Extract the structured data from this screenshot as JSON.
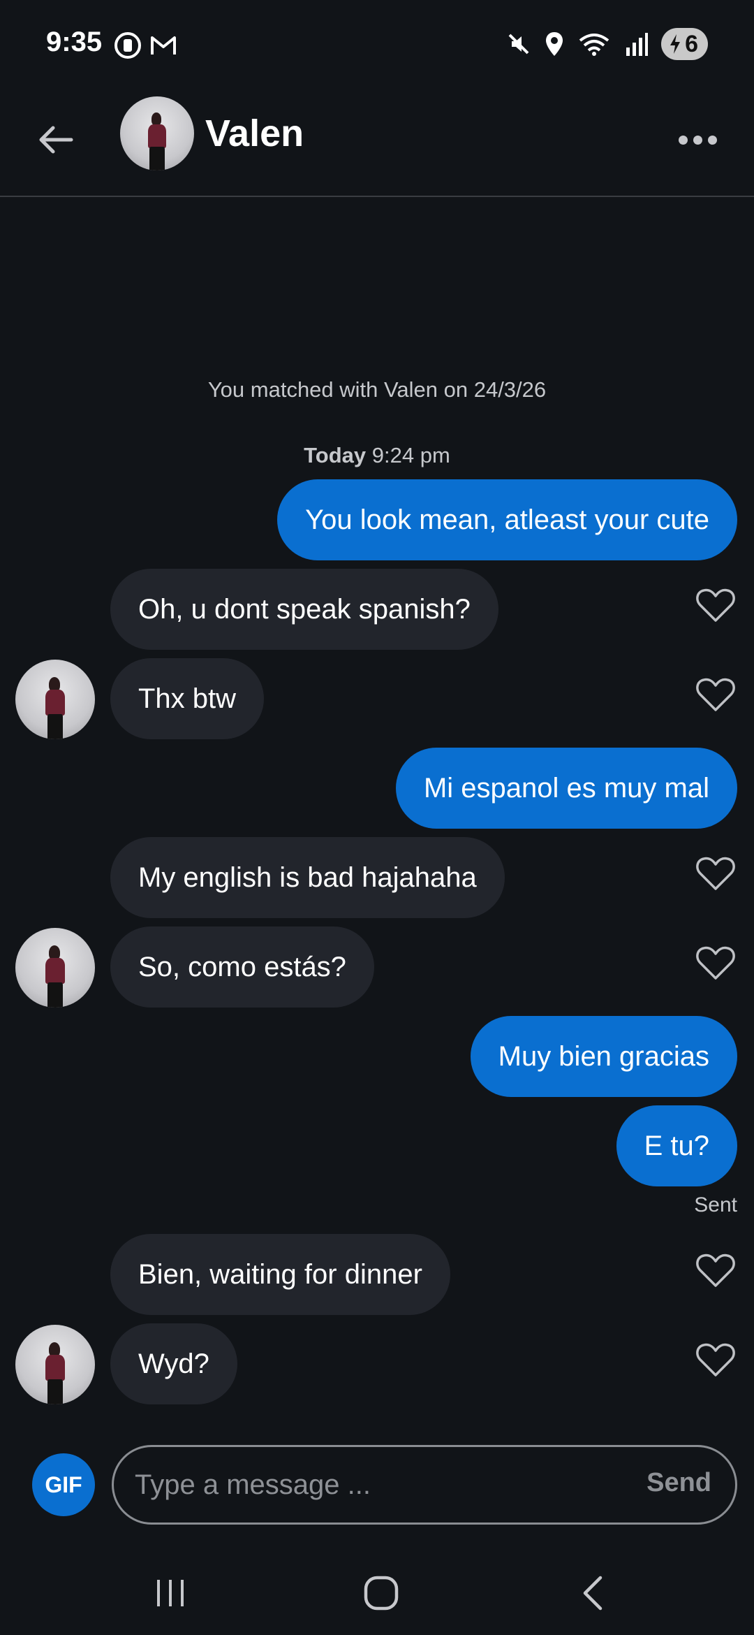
{
  "status_bar": {
    "time": "9:35",
    "battery": "6",
    "icons": [
      "whatsapp-icon",
      "gmail-icon",
      "mute-icon",
      "location-icon",
      "wifi-icon",
      "signal-icon",
      "battery-charging-icon"
    ]
  },
  "header": {
    "name": "Valen",
    "back_icon": "arrow-left-icon",
    "more_icon": "more-horizontal-icon"
  },
  "chat": {
    "match_text": "You matched with Valen on 24/3/26",
    "date_day": "Today",
    "date_time": "9:24 pm",
    "messages": [
      {
        "side": "out",
        "text": "You look mean, atleast your cute"
      },
      {
        "side": "in",
        "text": "Oh, u dont speak spanish?"
      },
      {
        "side": "in",
        "text": "Thx btw"
      },
      {
        "side": "out",
        "text": "Mi espanol es muy mal"
      },
      {
        "side": "in",
        "text": "My english is bad hajahaha"
      },
      {
        "side": "in",
        "text": "So, como estás?"
      },
      {
        "side": "out",
        "text": "Muy bien gracias"
      },
      {
        "side": "out",
        "text": "E tu?"
      },
      {
        "side": "in",
        "text": "Bien, waiting for dinner"
      },
      {
        "side": "in",
        "text": "Wyd?"
      }
    ],
    "sent_label": "Sent"
  },
  "composer": {
    "gif_label": "GIF",
    "placeholder": "Type a message ...",
    "value": "",
    "send_label": "Send"
  },
  "colors": {
    "background": "#111418",
    "outgoing_bubble": "#0a6fd0",
    "incoming_bubble": "#22252c",
    "accent": "#0a6fd0"
  }
}
